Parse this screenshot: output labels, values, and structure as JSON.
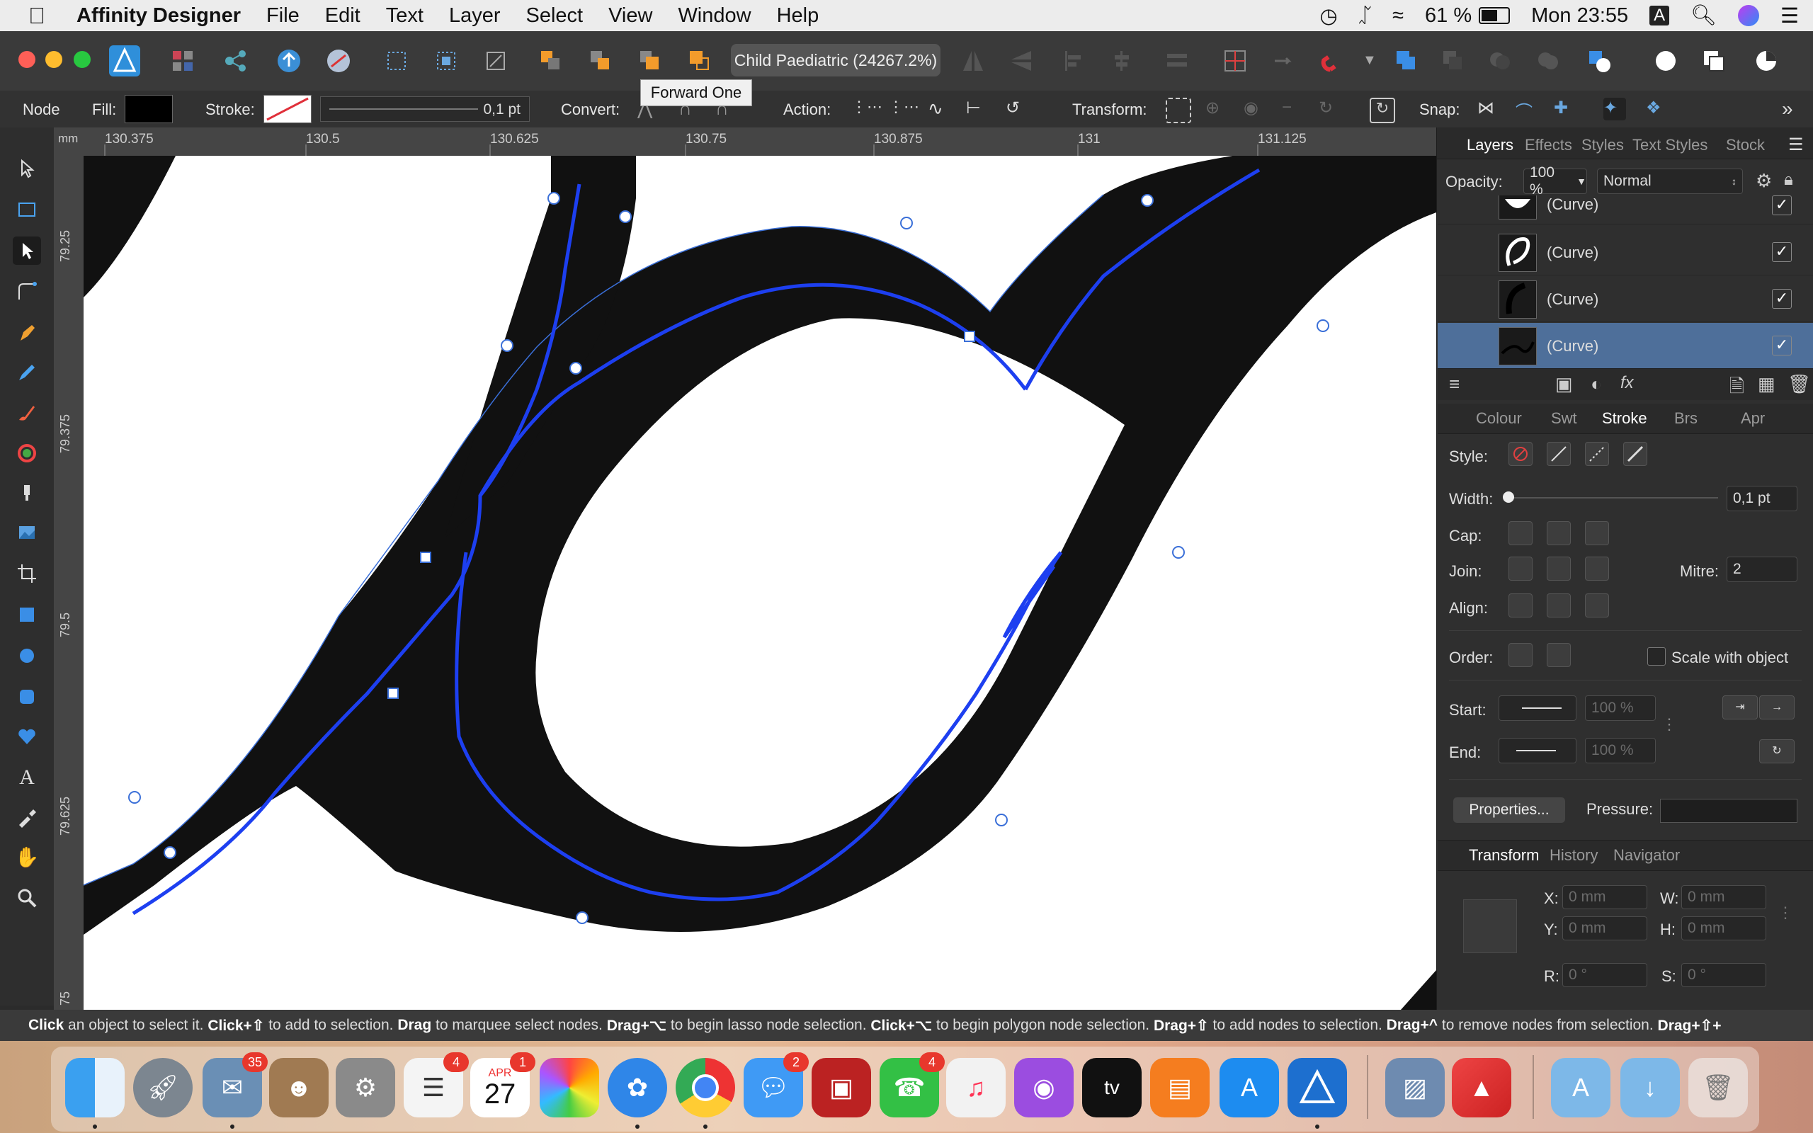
{
  "menubar": {
    "app_name": "Affinity Designer",
    "menus": [
      "File",
      "Edit",
      "Text",
      "Layer",
      "Select",
      "View",
      "Window",
      "Help"
    ],
    "battery": "61 %",
    "clock": "Mon 23:55",
    "input_source": "A"
  },
  "window": {
    "document_title": "Child Paediatric (24267.2%)",
    "tooltip": "Forward One"
  },
  "context": {
    "tool_name": "Node",
    "fill_label": "Fill:",
    "stroke_label": "Stroke:",
    "stroke_width": "0,1 pt",
    "convert_label": "Convert:",
    "action_label": "Action:",
    "transform_label": "Transform:",
    "snap_label": "Snap:"
  },
  "ruler": {
    "unit": "mm",
    "top_ticks": [
      "130.375",
      "130.5",
      "130.625",
      "130.75",
      "130.875",
      "131",
      "131.125"
    ],
    "left_ticks": [
      "79.25",
      "79.375",
      "79.5",
      "79.625",
      "75"
    ]
  },
  "panel": {
    "top_tabs": [
      "Layers",
      "Effects",
      "Styles",
      "Text Styles",
      "Stock"
    ],
    "opacity_label": "Opacity:",
    "opacity_value": "100 %",
    "blend_mode": "Normal",
    "layers": [
      {
        "name": "(Curve)",
        "visible": true
      },
      {
        "name": "(Curve)",
        "visible": true
      },
      {
        "name": "(Curve)",
        "visible": true
      },
      {
        "name": "(Curve)",
        "visible": true,
        "selected": true
      }
    ],
    "mid_tabs": [
      "Colour",
      "Swt",
      "Stroke",
      "Brs",
      "Apr"
    ],
    "style_label": "Style:",
    "width_label": "Width:",
    "width_value": "0,1 pt",
    "cap_label": "Cap:",
    "join_label": "Join:",
    "mitre_label": "Mitre:",
    "mitre_value": "2",
    "align_label": "Align:",
    "order_label": "Order:",
    "scale_label": "Scale with object",
    "start_label": "Start:",
    "start_pct": "100 %",
    "end_label": "End:",
    "end_pct": "100 %",
    "properties_button": "Properties...",
    "pressure_label": "Pressure:",
    "bottom_tabs": [
      "Transform",
      "History",
      "Navigator"
    ],
    "x_label": "X:",
    "x_value": "0 mm",
    "y_label": "Y:",
    "y_value": "0 mm",
    "w_label": "W:",
    "w_value": "0 mm",
    "h_label": "H:",
    "h_value": "0 mm",
    "r_label": "R:",
    "r_value": "0 °",
    "s_label": "S:",
    "s_value": "0 °"
  },
  "status": {
    "parts": [
      {
        "b": "Click",
        "t": " an object to select it. "
      },
      {
        "b": "Click+⇧",
        "t": " to add to selection. "
      },
      {
        "b": "Drag",
        "t": " to marquee select nodes. "
      },
      {
        "b": "Drag+⌥",
        "t": " to begin lasso node selection. "
      },
      {
        "b": "Click+⌥",
        "t": " to begin polygon node selection. "
      },
      {
        "b": "Drag+⇧",
        "t": " to add nodes to selection. "
      },
      {
        "b": "Drag+^",
        "t": " to remove nodes from selection. "
      },
      {
        "b": "Drag+⇧+",
        "t": ""
      }
    ]
  },
  "dock": {
    "badges": {
      "mail": "35",
      "reminders": "4",
      "calendar": "1",
      "messages": "2",
      "facetime": "4"
    },
    "calendar_month": "APR",
    "calendar_day": "27",
    "appletv_label": "tv"
  }
}
